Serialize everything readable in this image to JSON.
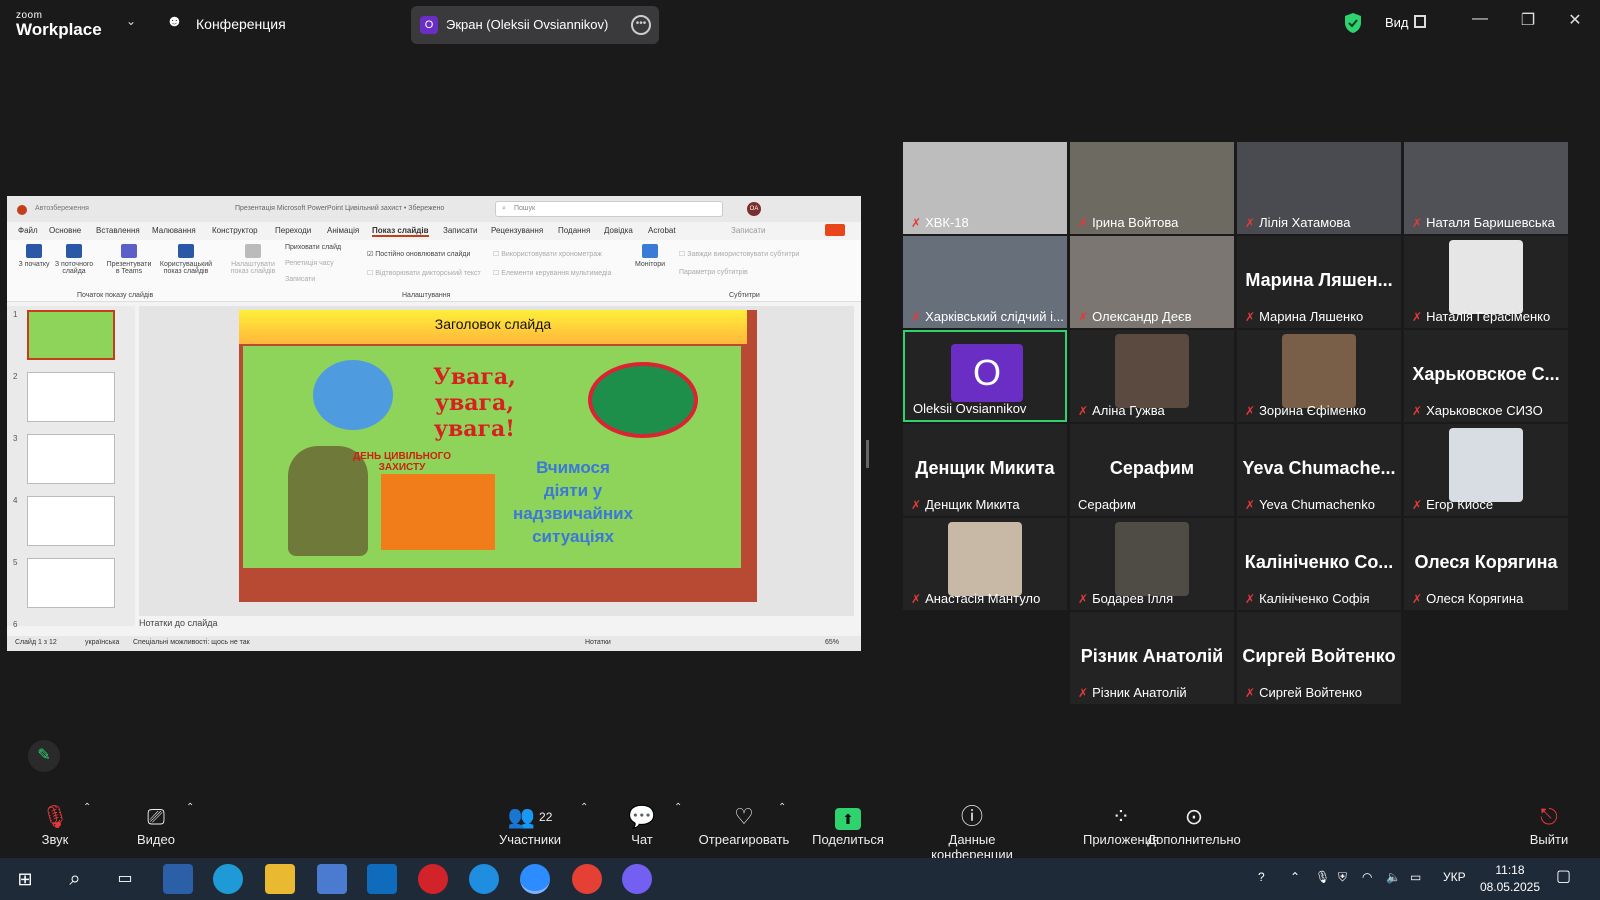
{
  "topbar": {
    "logo_small": "zoom",
    "logo_big": "Workplace",
    "conference_label": "Конференция",
    "share_avatar_letter": "O",
    "share_label": "Экран (Oleksii Ovsiannikov)",
    "view_label": "Вид"
  },
  "shared_screen": {
    "title_autosave": "Автозбереження",
    "title_file": "Презентація Microsoft PowerPoint Цивільний захист • Збережено",
    "search_placeholder": "Пошук",
    "user_initials": "OA",
    "tabs": [
      "Файл",
      "Основне",
      "Вставлення",
      "Малювання",
      "Конструктор",
      "Переходи",
      "Анімація",
      "Показ слайдів",
      "Записати",
      "Рецензування",
      "Подання",
      "Довідка",
      "Acrobat"
    ],
    "ribbon": {
      "from_start": "З початку",
      "from_current": "З поточного слайда",
      "present_teams": "Презентувати в Teams",
      "custom_show": "Користувацький показ слайдів",
      "setup_show": "Налаштувати показ слайдів",
      "hide_slide": "Приховати слайд",
      "rehearse": "Репетиція часу",
      "record": "Записати",
      "keep_updated": "Постійно оновлювати слайди",
      "narration": "Відтворювати дикторський текст",
      "timings": "Використовувати хронометраж",
      "media_controls": "Елементи керування мультимедіа",
      "monitor": "Монітори",
      "subtitles_always": "Завжди використовувати субтитри",
      "subtitle_settings": "Параметри субтитрів",
      "group_start": "Початок показу слайдів",
      "group_setup": "Налаштування",
      "group_subtitles": "Субтитри",
      "record_btn": "Записати"
    },
    "thumb_numbers": [
      "1",
      "2",
      "3",
      "4",
      "5",
      "6"
    ],
    "slide": {
      "title": "Заголовок слайда",
      "line1": "Увага,",
      "line2": "увага,",
      "line3": "увага!",
      "day1": "ДЕНЬ ЦИВІЛЬНОГО",
      "day2": "ЗАХИСТУ",
      "learn1": "Вчимося",
      "learn2": "діяти у",
      "learn3": "надзвичайних",
      "learn4": "ситуаціях"
    },
    "notes": "Нотатки до слайда",
    "status_slide": "Слайд 1 з 12",
    "status_lang": "українська",
    "status_access": "Спеціальні можливості: щось не так",
    "status_notes": "Нотатки",
    "status_zoom": "65%"
  },
  "participants": [
    {
      "name": "ХВК-18",
      "big": ""
    },
    {
      "name": "Ірина Войтова",
      "big": ""
    },
    {
      "name": "Лілія Хатамова",
      "big": ""
    },
    {
      "name": "Наталя Баришевська",
      "big": ""
    },
    {
      "name": "Харківський слідчий і...",
      "big": ""
    },
    {
      "name": "Олександр Деєв",
      "big": ""
    },
    {
      "name": "Марина Ляшенко",
      "big": "Марина Ляшен..."
    },
    {
      "name": "Наталія Герасіменко",
      "big": ""
    },
    {
      "name": "Oleksii Ovsiannikov",
      "big": ""
    },
    {
      "name": "Аліна Гужва",
      "big": ""
    },
    {
      "name": "Зорина Єфіменко",
      "big": ""
    },
    {
      "name": "Харьковское СИЗО",
      "big": "Харьковское С..."
    },
    {
      "name": "Денщик Микита",
      "big": "Денщик Микита"
    },
    {
      "name": "Серафим",
      "big": "Серафим"
    },
    {
      "name": "Yeva Chumachenko",
      "big": "Yeva Chumache..."
    },
    {
      "name": "Егор Киосе",
      "big": ""
    },
    {
      "name": "Анастасія Мантуло",
      "big": ""
    },
    {
      "name": "Бодарев Ілля",
      "big": ""
    },
    {
      "name": "Калініченко Софія",
      "big": "Калініченко Со..."
    },
    {
      "name": "Олеся Корягина",
      "big": "Олеся Корягина"
    },
    {
      "name": "Різник Анатолій",
      "big": "Різник Анатолій"
    },
    {
      "name": "Сиргей Войтенко",
      "big": "Сиргей Войтенко"
    }
  ],
  "active_avatar_letter": "O",
  "toolbar": {
    "audio": "Звук",
    "video": "Видео",
    "participants": "Участники",
    "participants_count": "22",
    "chat": "Чат",
    "react": "Отреагировать",
    "share": "Поделиться",
    "info": "Данные конференции",
    "apps": "Приложения",
    "more": "Дополнительно",
    "leave": "Выйти"
  },
  "taskbar": {
    "lang": "УКР",
    "time": "11:18",
    "date": "08.05.2025"
  },
  "colors": {
    "accent_green": "#2fd36e",
    "mic_muted": "#e5383b",
    "avatar_purple": "#6b2ec4"
  }
}
